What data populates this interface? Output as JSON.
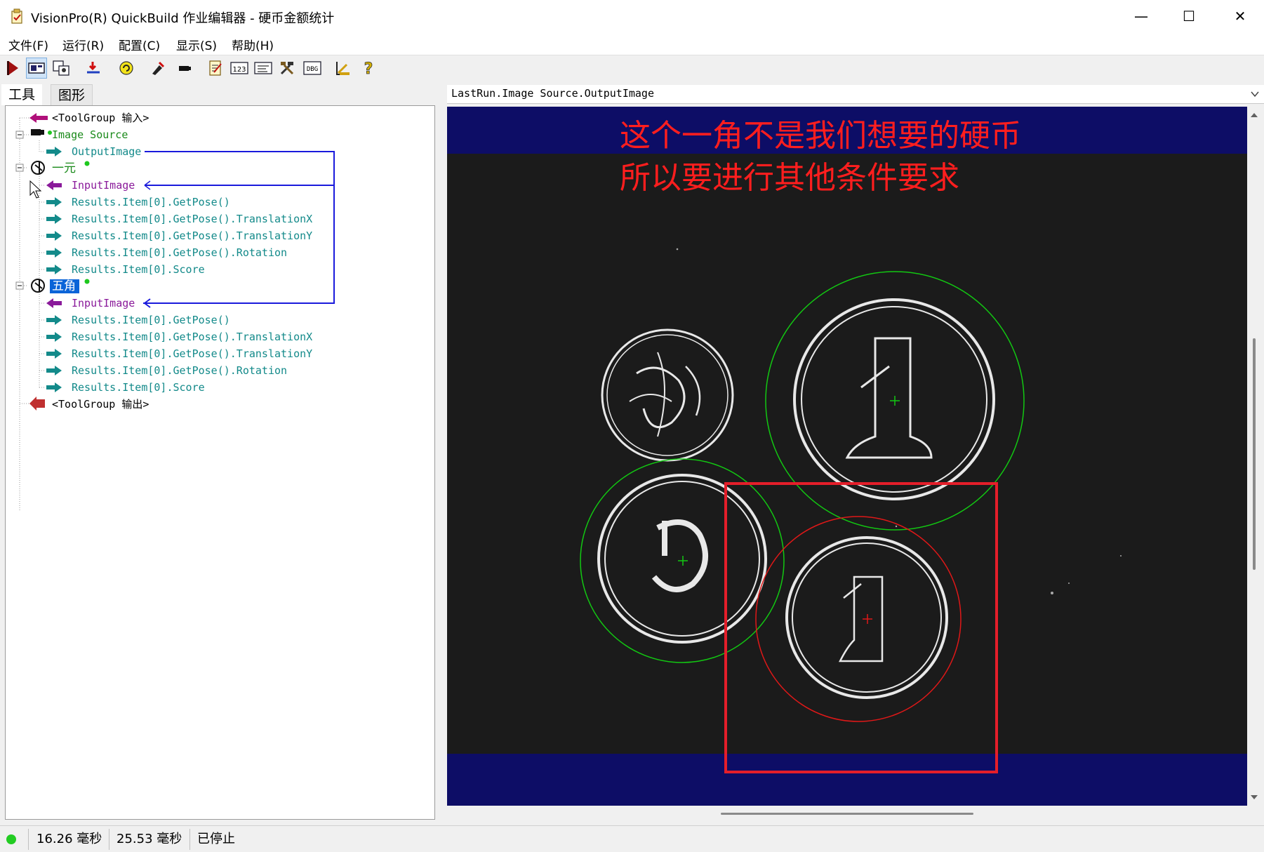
{
  "window": {
    "title": "VisionPro(R) QuickBuild 作业编辑器 - 硬币金额统计",
    "minimize_glyph": "—",
    "maximize_glyph": "☐",
    "close_glyph": "✕"
  },
  "menu": [
    "文件(F)",
    "运行(R)",
    "配置(C)",
    "显示(S)",
    "帮助(H)"
  ],
  "toolbar": {
    "buttons": [
      "run-once-icon",
      "image-display-icon",
      "tool-properties-icon",
      "reset-icon",
      "run-continuous-icon",
      "edit-icon",
      "camera-icon",
      "notepad-icon",
      "results-123-icon",
      "terminal-icon",
      "tools-icon",
      "dbg-icon",
      "measure-icon",
      "help-icon"
    ]
  },
  "tabs": {
    "tools": "工具",
    "graphics": "图形"
  },
  "tree": {
    "input_group": "<ToolGroup 输入>",
    "image_source": "Image Source",
    "output_image": "OutputImage",
    "tool1_name": "一元",
    "tool1_input": "InputImage",
    "tool1_results": [
      "Results.Item[0].GetPose()",
      "Results.Item[0].GetPose().TranslationX",
      "Results.Item[0].GetPose().TranslationY",
      "Results.Item[0].GetPose().Rotation",
      "Results.Item[0].Score"
    ],
    "tool2_name": "五角",
    "tool2_input": "InputImage",
    "tool2_results": [
      "Results.Item[0].GetPose()",
      "Results.Item[0].GetPose().TranslationX",
      "Results.Item[0].GetPose().TranslationY",
      "Results.Item[0].GetPose().Rotation",
      "Results.Item[0].Score"
    ],
    "output_group": "<ToolGroup 输出>"
  },
  "image_panel": {
    "header": "LastRun.Image Source.OutputImage",
    "annotation_line1": "这个一角不是我们想要的硬币",
    "annotation_line2": "所以要进行其他条件要求"
  },
  "status": {
    "time1": "16.26 毫秒",
    "time2": "25.53 毫秒",
    "state": "已停止",
    "indicator_color": "#22cc22"
  }
}
